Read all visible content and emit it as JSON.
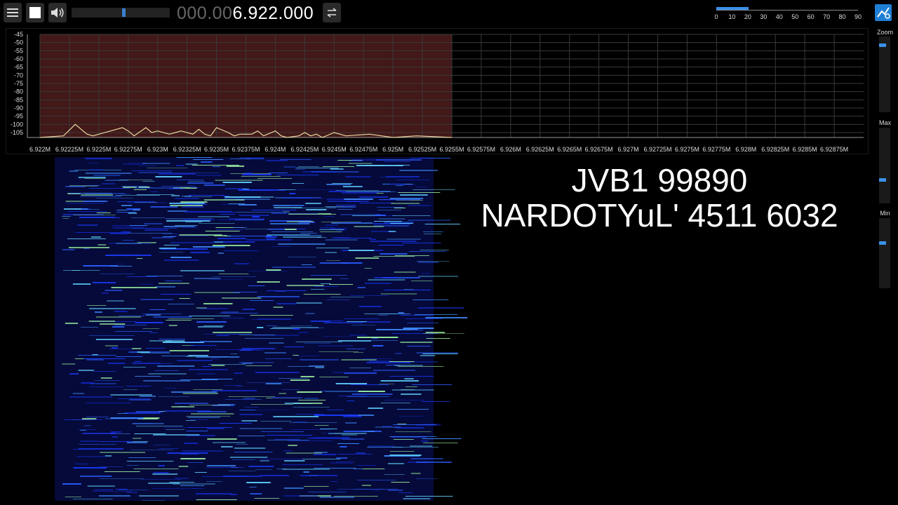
{
  "toolbar": {
    "menu_icon": "hamburger-icon",
    "stop_icon": "stop-icon",
    "volume_icon": "speaker-icon",
    "volume_level": 0.52,
    "freq_prefix": "000.00",
    "freq_main": "6.922.000",
    "swap_icon": "swap-arrows-icon"
  },
  "scale": {
    "labels": [
      "0",
      "10",
      "20",
      "30",
      "40",
      "50",
      "60",
      "70",
      "80",
      "90"
    ],
    "fill_fraction": 0.23
  },
  "sidebar": {
    "zoom_label": "Zoom",
    "max_label": "Max",
    "min_label": "Min",
    "zoom_level": 0.1,
    "max_level": 0.7,
    "min_level": 0.35
  },
  "overlay": {
    "line1": "JVB1 99890",
    "line2": "NARDOTYuL' 4511 6032"
  },
  "colors": {
    "accent": "#3a90e8",
    "passband": "#5a2020",
    "trace": "#e8d8a0"
  },
  "chart_data": {
    "type": "line",
    "ylim": [
      -108,
      -45
    ],
    "yticks": [
      "-45",
      "-50",
      "-55",
      "-60",
      "-65",
      "-70",
      "-75",
      "-80",
      "-85",
      "-90",
      "-95",
      "-100",
      "-105"
    ],
    "xticks": [
      "6.922M",
      "6.92225M",
      "6.9225M",
      "6.92275M",
      "6.923M",
      "6.92325M",
      "6.9235M",
      "6.92375M",
      "6.924M",
      "6.92425M",
      "6.9245M",
      "6.92475M",
      "6.925M",
      "6.92525M",
      "6.9255M",
      "6.92575M",
      "6.926M",
      "6.92625M",
      "6.9265M",
      "6.92675M",
      "6.927M",
      "6.92725M",
      "6.9275M",
      "6.92775M",
      "6.928M",
      "6.92825M",
      "6.9285M",
      "6.92875M"
    ],
    "xlim": [
      6.922,
      6.929
    ],
    "passband": [
      6.922,
      6.9255
    ],
    "series": [
      {
        "x": [
          6.922,
          6.9222,
          6.9223,
          6.9224,
          6.92245,
          6.9225,
          6.9226,
          6.9227,
          6.92275,
          6.9228,
          6.9229,
          6.92295,
          6.923,
          6.9231,
          6.92315,
          6.9232,
          6.9233,
          6.92335,
          6.9234,
          6.92345,
          6.9235,
          6.9236,
          6.92365,
          6.9237,
          6.9238,
          6.92385,
          6.9239,
          6.924,
          6.92405,
          6.9241,
          6.9242,
          6.92425,
          6.9243,
          6.92435,
          6.9244,
          6.9245,
          6.9246,
          6.9248,
          6.925,
          6.9252,
          6.9255
        ],
        "y": [
          -108,
          -107,
          -100,
          -106,
          -107,
          -106,
          -104,
          -102,
          -104,
          -107,
          -102,
          -105,
          -104,
          -106,
          -105,
          -104,
          -106,
          -103,
          -106,
          -107,
          -102,
          -105,
          -107,
          -106,
          -106,
          -104,
          -107,
          -104,
          -107,
          -108,
          -107,
          -105,
          -107,
          -106,
          -108,
          -105,
          -107,
          -106,
          -108,
          -107,
          -108
        ]
      }
    ]
  }
}
